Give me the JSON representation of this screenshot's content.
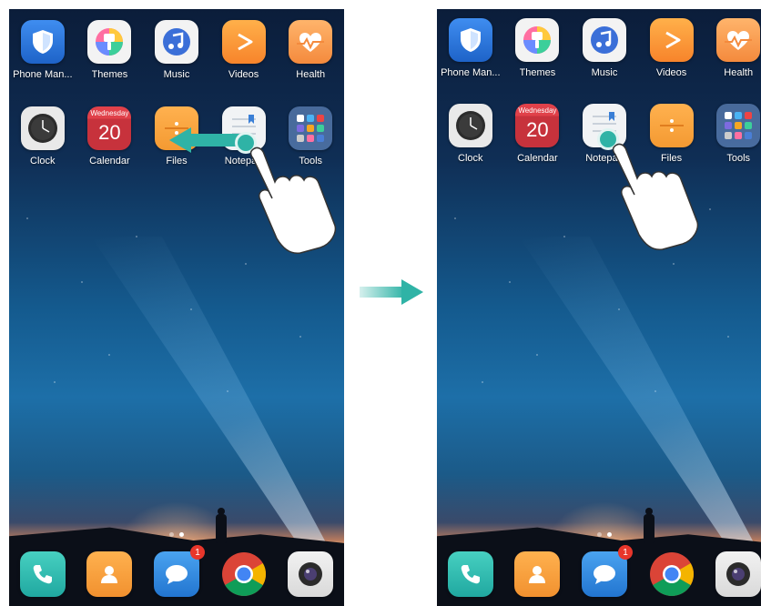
{
  "left_screen": {
    "row1": [
      "Phone Man...",
      "Themes",
      "Music",
      "Videos",
      "Health"
    ],
    "row2": [
      "Clock",
      "Calendar",
      "Files",
      "Notepad",
      "Tools"
    ],
    "calendar_day": "Wednesday",
    "calendar_date": "20",
    "badge": "1"
  },
  "right_screen": {
    "row1": [
      "Phone Man...",
      "Themes",
      "Music",
      "Videos",
      "Health"
    ],
    "row2": [
      "Clock",
      "Calendar",
      "Notepad",
      "Files",
      "Tools"
    ],
    "calendar_day": "Wednesday",
    "calendar_date": "20",
    "badge": "1"
  },
  "icons": {
    "phone_manager": "shield-icon",
    "themes": "brush-icon",
    "music": "music-note-icon",
    "videos": "play-icon",
    "health": "heart-icon",
    "clock": "clock-icon",
    "files": "folder-icon",
    "notepad": "notepad-icon",
    "tools": "folder-grid-icon",
    "dock": [
      "phone-icon",
      "contacts-icon",
      "messages-icon",
      "chrome-icon",
      "camera-icon"
    ]
  },
  "colors": {
    "accent": "#2fb3a6",
    "badge": "#e8362b"
  }
}
